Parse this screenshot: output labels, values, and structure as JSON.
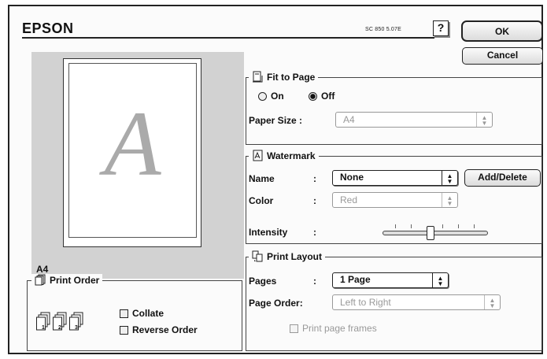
{
  "header": {
    "brand": "EPSON",
    "model": "SC 850 5.07E",
    "help_glyph": "?",
    "ok_label": "OK",
    "cancel_label": "Cancel"
  },
  "preview": {
    "letter": "A",
    "paper_size": "A4"
  },
  "fit_to_page": {
    "title": "Fit to Page",
    "on_label": "On",
    "off_label": "Off",
    "selected": "Off",
    "paper_size_label": "Paper Size :",
    "paper_size_value": "A4",
    "paper_size_enabled": false
  },
  "watermark": {
    "title": "Watermark",
    "name_label": "Name",
    "name_value": "None",
    "add_delete_label": "Add/Delete",
    "color_label": "Color",
    "color_value": "Red",
    "intensity_label": "Intensity",
    "colon": ":",
    "intensity_level": 0.45
  },
  "print_layout": {
    "title": "Print Layout",
    "pages_label": "Pages",
    "pages_value": "1 Page",
    "page_order_label": "Page Order:",
    "page_order_value": "Left to Right",
    "frames_label": "Print page frames",
    "frames_checked": false,
    "colon": ":"
  },
  "print_order": {
    "title": "Print Order",
    "collate_label": "Collate",
    "collate_checked": false,
    "reverse_label": "Reverse Order",
    "reverse_checked": false,
    "icon_numbers": [
      "1",
      "2",
      "3"
    ]
  },
  "icons": {
    "help": "question-mark-icon",
    "fit_to_page": "fit-page-icon",
    "watermark": "watermark-icon",
    "print_layout": "layout-icon",
    "print_order": "stacked-pages-icon",
    "popup_arrows": "up-down-arrows-icon"
  }
}
